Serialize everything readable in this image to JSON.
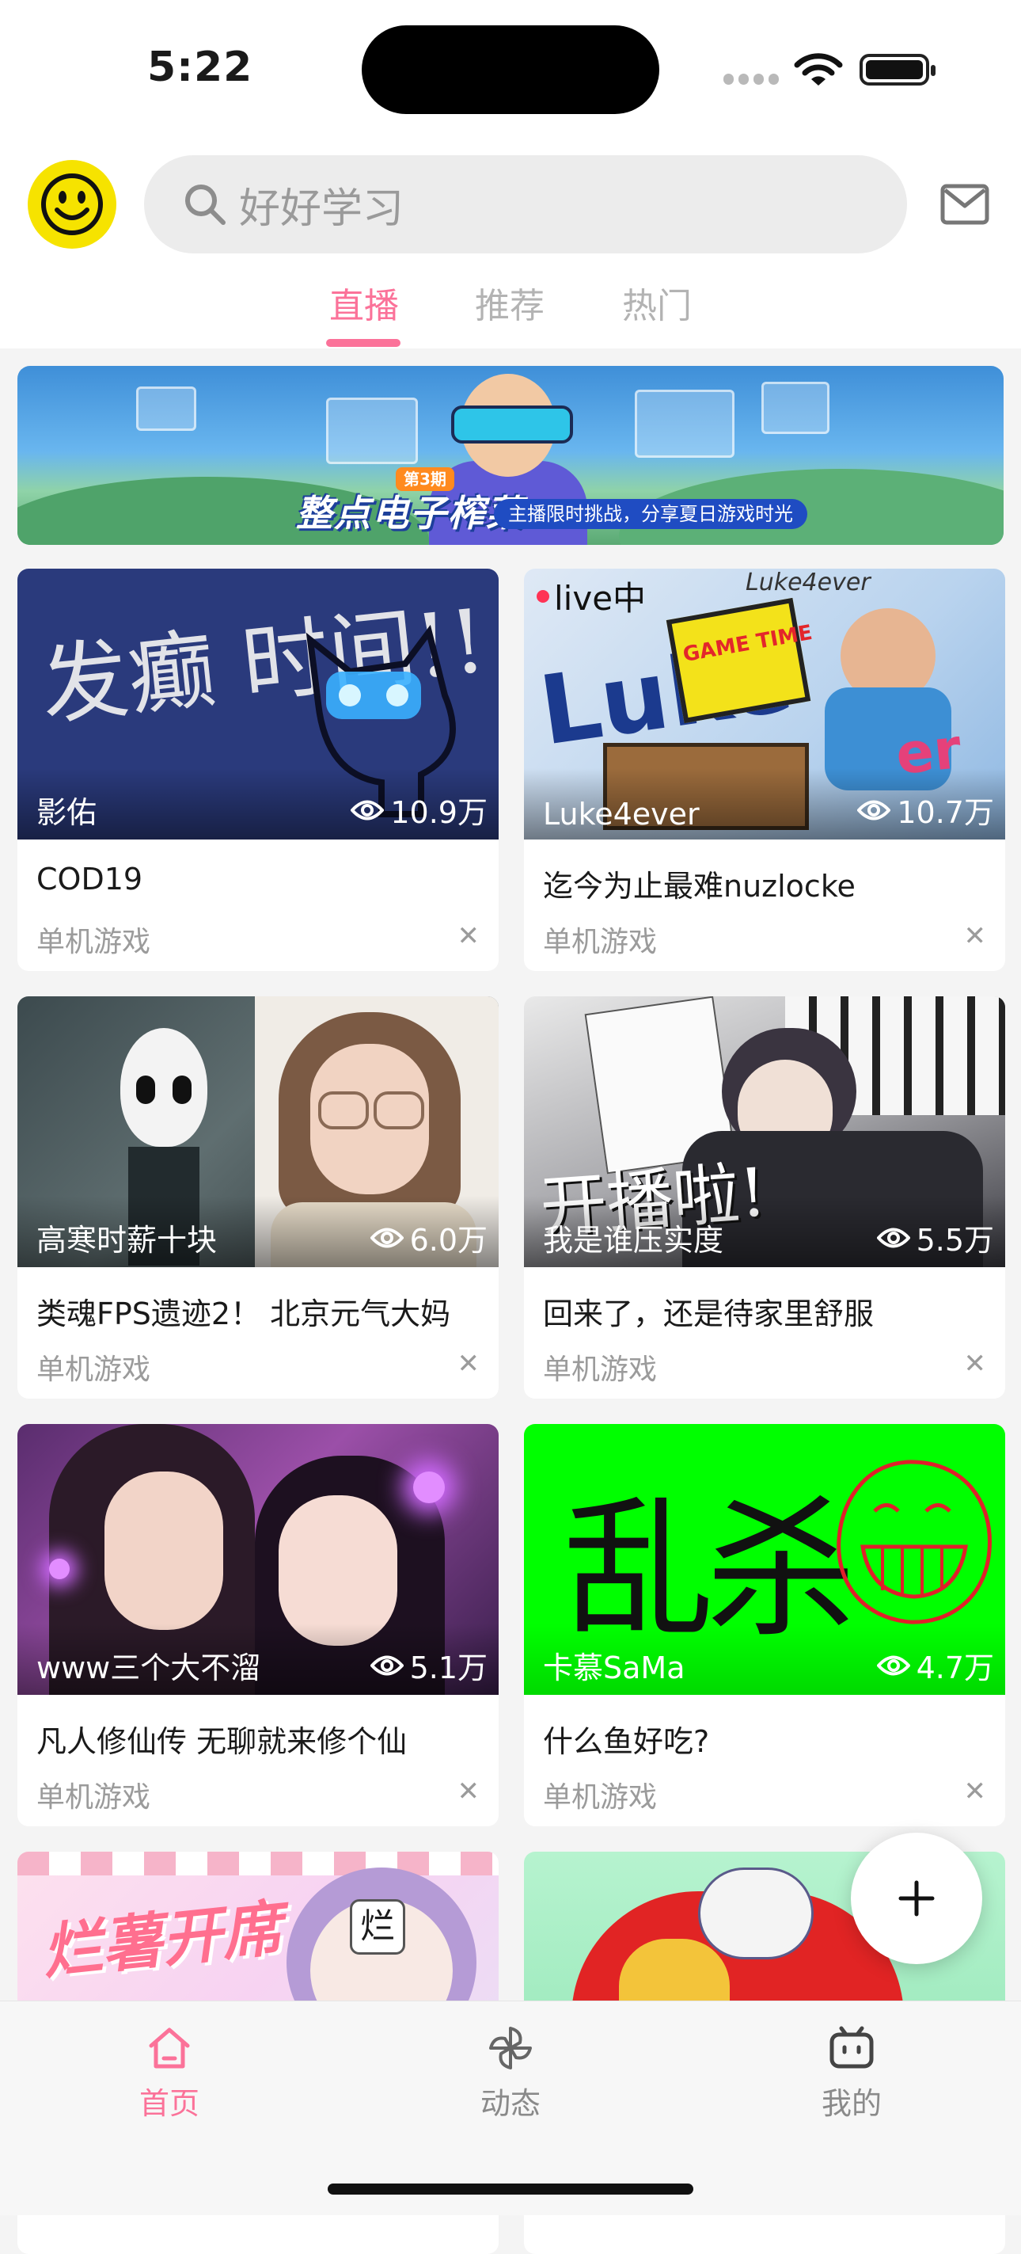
{
  "status": {
    "time": "5:22"
  },
  "header": {
    "search_placeholder": "好好学习",
    "tabs": [
      {
        "label": "直播",
        "active": true
      },
      {
        "label": "推荐",
        "active": false
      },
      {
        "label": "热门",
        "active": false
      }
    ]
  },
  "banner": {
    "title": "整点电子榨菜",
    "tag": "第3期",
    "subtitle": "主播限时挑战，分享夏日游戏时光"
  },
  "cards": [
    {
      "streamer": "影佑",
      "views": "10.9万",
      "title": "COD19",
      "category": "单机游戏",
      "thumb_text": "发癫 时间!!"
    },
    {
      "streamer": "Luke4ever",
      "views": "10.7万",
      "title": "迄今为止最难nuzlocke",
      "category": "单机游戏",
      "live_badge": "live中",
      "thumb_text": "Luke",
      "thumb_text2": "GAME TIME",
      "thumb_text3": "Luke4ever"
    },
    {
      "streamer": "高寒时薪十块",
      "views": "6.0万",
      "title": "类魂FPS遗迹2！ 北京元气大妈",
      "category": "单机游戏"
    },
    {
      "streamer": "我是谁压实度",
      "views": "5.5万",
      "title": "回来了，还是待家里舒服",
      "category": "单机游戏",
      "thumb_text": "开播啦!"
    },
    {
      "streamer": "www三个大不溜",
      "views": "5.1万",
      "title": "凡人修仙传 无聊就来修个仙",
      "category": "单机游戏"
    },
    {
      "streamer": "卡慕SaMa",
      "views": "4.7万",
      "title": "什么鱼好吃?",
      "category": "单机游戏",
      "thumb_text": "乱杀"
    },
    {
      "thumb_text": "烂薯开席",
      "thumb_text2": "烂"
    },
    {}
  ],
  "fab": {
    "icon": "plus-icon"
  },
  "tabbar": [
    {
      "label": "首页",
      "icon": "home-icon",
      "active": true
    },
    {
      "label": "动态",
      "icon": "pinwheel-icon",
      "active": false
    },
    {
      "label": "我的",
      "icon": "tv-icon",
      "active": false
    }
  ],
  "colors": {
    "accent": "#fb7299",
    "background": "#f4f4f4",
    "avatar": "#f6e300"
  }
}
